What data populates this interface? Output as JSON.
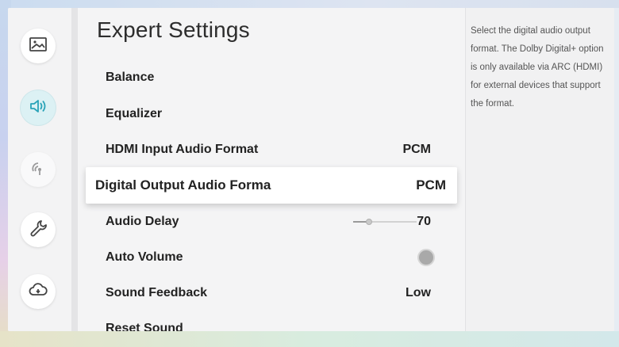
{
  "sidebar": {
    "items": [
      {
        "icon": "picture-icon",
        "state": "inactive"
      },
      {
        "icon": "sound-icon",
        "state": "active"
      },
      {
        "icon": "broadcasting-icon",
        "state": "disabled"
      },
      {
        "icon": "wrench-icon",
        "state": "inactive"
      },
      {
        "icon": "cloud-support-icon",
        "state": "inactive"
      }
    ]
  },
  "main": {
    "title": "Expert Settings",
    "rows": [
      {
        "label": "Balance",
        "value": ""
      },
      {
        "label": "Equalizer",
        "value": ""
      },
      {
        "label": "HDMI Input Audio Format",
        "value": "PCM"
      },
      {
        "label": "Digital Output Audio Forma",
        "value": "PCM"
      },
      {
        "label": "Audio Delay",
        "value": "70",
        "slider_fraction": 0.25
      },
      {
        "label": "Auto Volume",
        "value": "",
        "toggle_on": false
      },
      {
        "label": "Sound Feedback",
        "value": "Low"
      },
      {
        "label": "Reset Sound",
        "value": ""
      }
    ]
  },
  "help": {
    "text": "Select the digital audio output format. The Dolby Digital+ option is only available via ARC (HDMI) for external devices that support the format."
  },
  "colors": {
    "selected_row_bg": "#ffffff",
    "active_icon_bg": "#dcf1f4",
    "accent_icon": "#2aa3b8"
  }
}
